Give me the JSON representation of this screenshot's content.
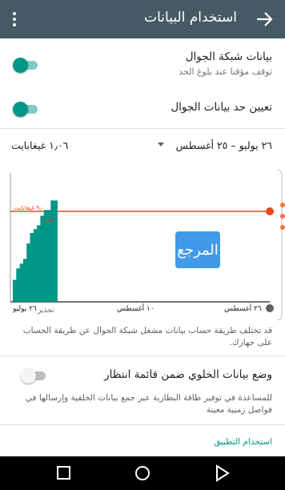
{
  "toolbar": {
    "title": "استخدام البيانات",
    "back_icon": "arrow-right-icon",
    "menu_icon": "more-vert-icon",
    "background": "#455a64"
  },
  "mobile_data": {
    "title": "بيانات شبكة الجوال",
    "subtitle": "ثوقف مؤقتا عند بلوغ الحد",
    "enabled": true
  },
  "data_limit": {
    "title": "تعيين حد بيانات الجوال",
    "enabled": true
  },
  "cycle": {
    "range": "٢٦ يوليو – ٢٥ أغسطس",
    "total": "١٫٠٦ غيغابايت"
  },
  "chart": {
    "limit_label": "٩٫٠ غيغابايت",
    "limit_word": "الحد",
    "warning_label": "تحذير",
    "date_labels": [
      "٢٦ يوليو",
      "١٠ أغسطس",
      "٢٦ أغسطس"
    ],
    "usage_color": "#009688",
    "limit_color": "#e64a19",
    "watermark": "المرجع"
  },
  "chart_data": {
    "type": "area",
    "x_start": "٢٦ يوليو",
    "x_end": "٢٦ أغسطس",
    "x_ticks": [
      "٢٦ يوليو",
      "١٠ أغسطس",
      "٢٦ أغسطس"
    ],
    "limit": 9.0,
    "usage_days": [
      0,
      1,
      2,
      3,
      4,
      5,
      6,
      7,
      8,
      9,
      10,
      11,
      12
    ],
    "usage_values": [
      2.3,
      3.5,
      4.0,
      4.5,
      6.1,
      7.2,
      7.6,
      8.0,
      9.0,
      9.6,
      9.6,
      10.6,
      10.6
    ]
  },
  "chart_note": "قد تختلف طريقة حساب بيانات مشغل شبكة الجوال عن طريقة الحساب على جهازك.",
  "background_data": {
    "title": "وضع بيانات الخلوي ضمن قائمة انتظار",
    "description": "للمساعدة في توفير طاقة البطارية عبر جمع بيانات الخلفية وإرسالها في فواصل زمنية معينة",
    "enabled": false
  },
  "app_usage_link": "استخدام التطبيق",
  "nav": {
    "back_icon": "nav-back-icon",
    "home_icon": "nav-home-icon",
    "recents_icon": "nav-recents-icon"
  }
}
